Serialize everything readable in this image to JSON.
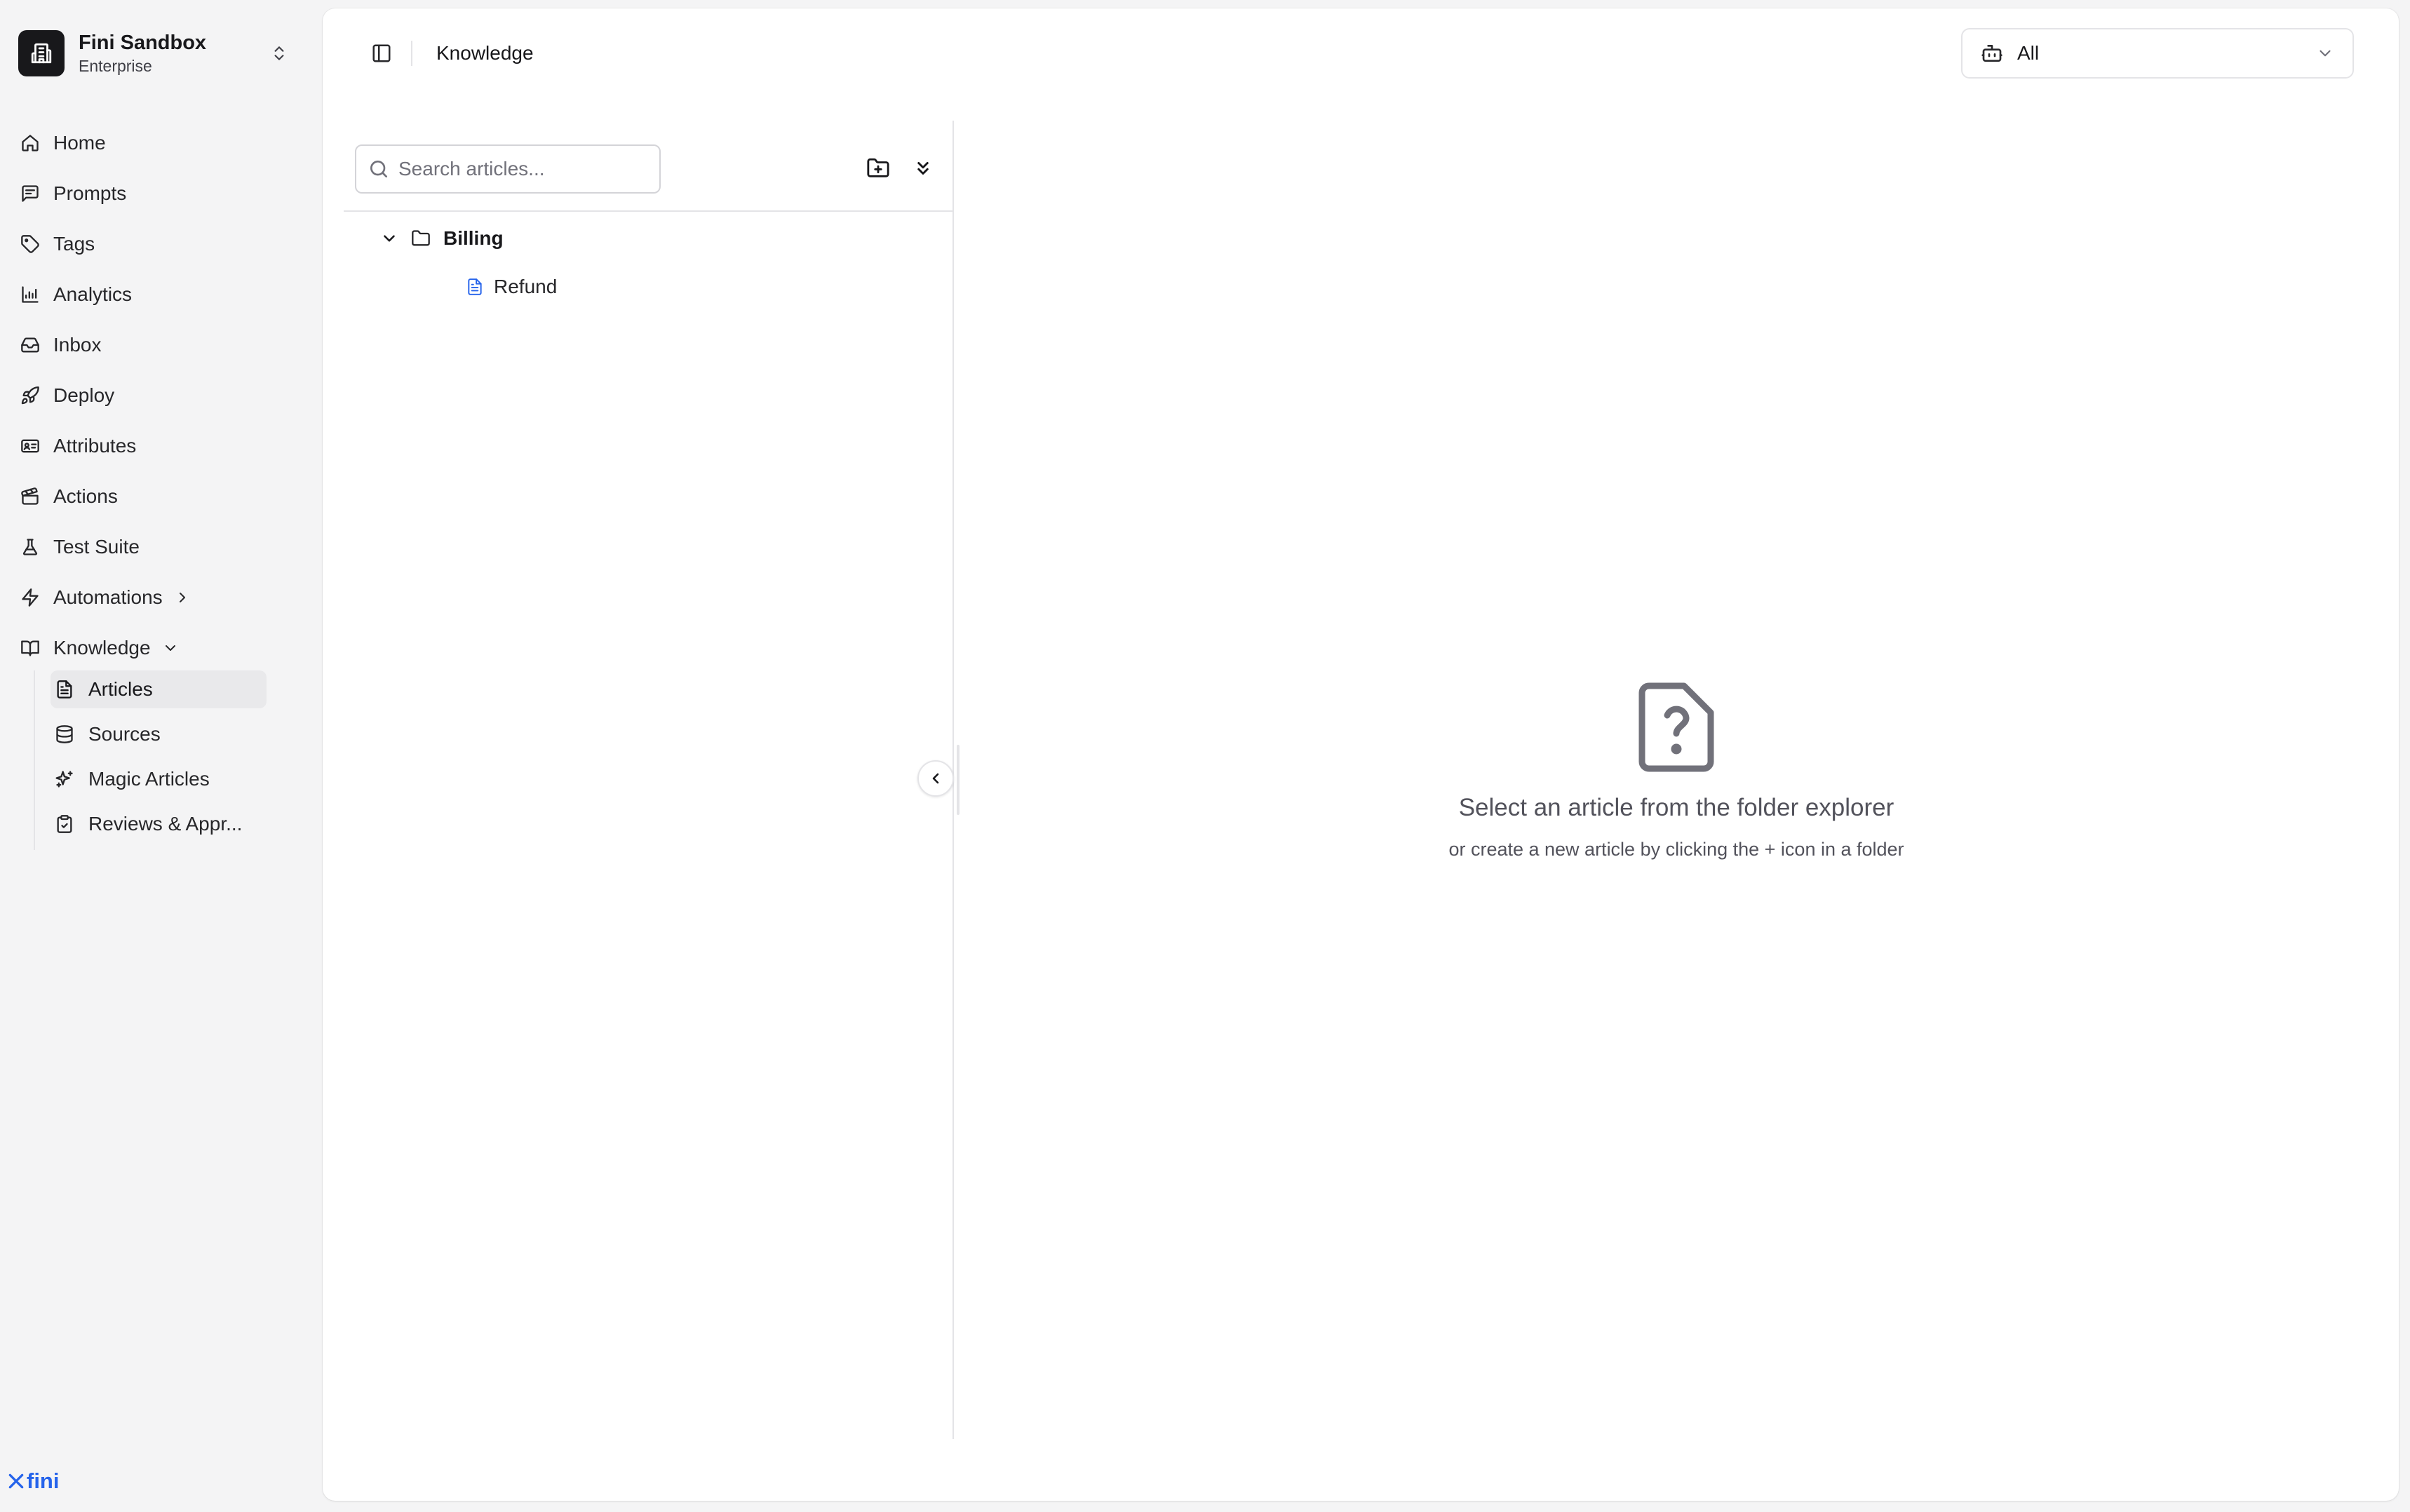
{
  "workspace": {
    "name": "Fini Sandbox",
    "plan": "Enterprise"
  },
  "sidebar": {
    "items": [
      {
        "label": "Home",
        "icon": "home-icon"
      },
      {
        "label": "Prompts",
        "icon": "message-square-icon"
      },
      {
        "label": "Tags",
        "icon": "tag-icon"
      },
      {
        "label": "Analytics",
        "icon": "bar-chart-icon"
      },
      {
        "label": "Inbox",
        "icon": "inbox-icon"
      },
      {
        "label": "Deploy",
        "icon": "rocket-icon"
      },
      {
        "label": "Attributes",
        "icon": "id-card-icon"
      },
      {
        "label": "Actions",
        "icon": "clapperboard-icon"
      },
      {
        "label": "Test Suite",
        "icon": "flask-icon"
      },
      {
        "label": "Automations",
        "icon": "zap-icon",
        "trailing": "chevron-right-icon"
      },
      {
        "label": "Knowledge",
        "icon": "book-open-icon",
        "trailing": "chevron-down-icon",
        "expanded": true
      }
    ],
    "knowledge_subitems": [
      {
        "label": "Articles",
        "icon": "file-text-icon",
        "active": true
      },
      {
        "label": "Sources",
        "icon": "database-icon"
      },
      {
        "label": "Magic Articles",
        "icon": "sparkles-icon"
      },
      {
        "label": "Reviews & Appr...",
        "icon": "clipboard-check-icon"
      }
    ],
    "brand": "fini"
  },
  "header": {
    "title": "Knowledge",
    "bot_select": {
      "value": "All",
      "icon": "bot-icon"
    }
  },
  "explorer": {
    "search_placeholder": "Search articles...",
    "folders": [
      {
        "name": "Billing",
        "expanded": true,
        "articles": [
          {
            "name": "Refund"
          }
        ]
      }
    ]
  },
  "empty_state": {
    "title": "Select an article from the folder explorer",
    "subtitle": "or create a new article by clicking the + icon in a folder"
  },
  "colors": {
    "accent": "#2563eb",
    "sidebar_bg": "#f4f4f5",
    "active_bg": "#e9e9eb"
  }
}
